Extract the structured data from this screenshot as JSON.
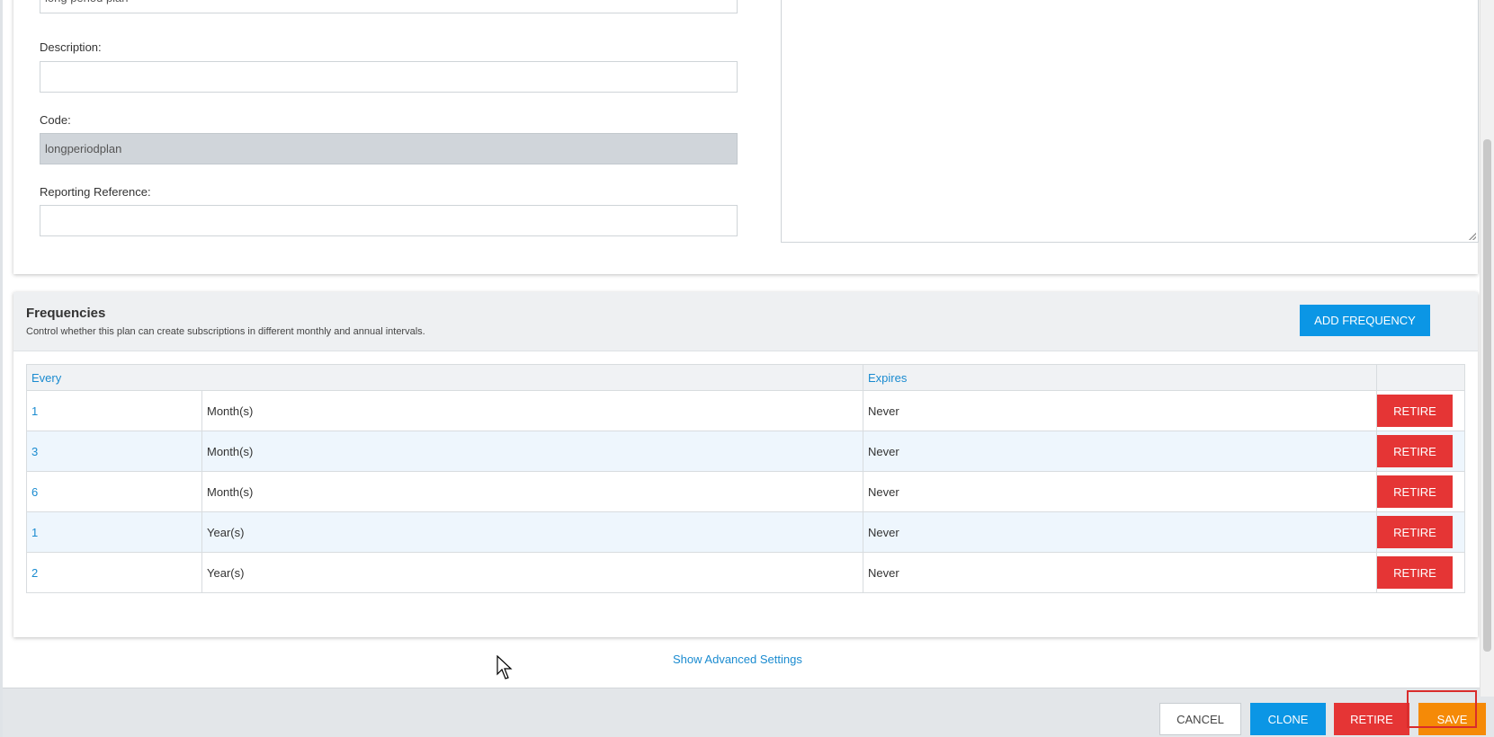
{
  "form": {
    "name_value": "long period plan",
    "description_label": "Description:",
    "description_value": "",
    "code_label": "Code:",
    "code_value": "longperiodplan",
    "reporting_label": "Reporting Reference:",
    "reporting_value": ""
  },
  "frequencies": {
    "title": "Frequencies",
    "subtitle": "Control whether this plan can create subscriptions in different monthly and annual intervals.",
    "add_label": "ADD FREQUENCY",
    "columns": {
      "every": "Every",
      "expires": "Expires"
    },
    "rows": [
      {
        "number": "1",
        "unit": "Month(s)",
        "expires": "Never",
        "action": "RETIRE"
      },
      {
        "number": "3",
        "unit": "Month(s)",
        "expires": "Never",
        "action": "RETIRE"
      },
      {
        "number": "6",
        "unit": "Month(s)",
        "expires": "Never",
        "action": "RETIRE"
      },
      {
        "number": "1",
        "unit": "Year(s)",
        "expires": "Never",
        "action": "RETIRE"
      },
      {
        "number": "2",
        "unit": "Year(s)",
        "expires": "Never",
        "action": "RETIRE"
      }
    ]
  },
  "advanced_link": "Show Advanced Settings",
  "footer": {
    "cancel": "CANCEL",
    "clone": "CLONE",
    "retire": "RETIRE",
    "save": "SAVE"
  },
  "colors": {
    "blue": "#0b96e5",
    "red": "#e53535",
    "orange": "#f58a07",
    "link": "#1a8bd0"
  }
}
